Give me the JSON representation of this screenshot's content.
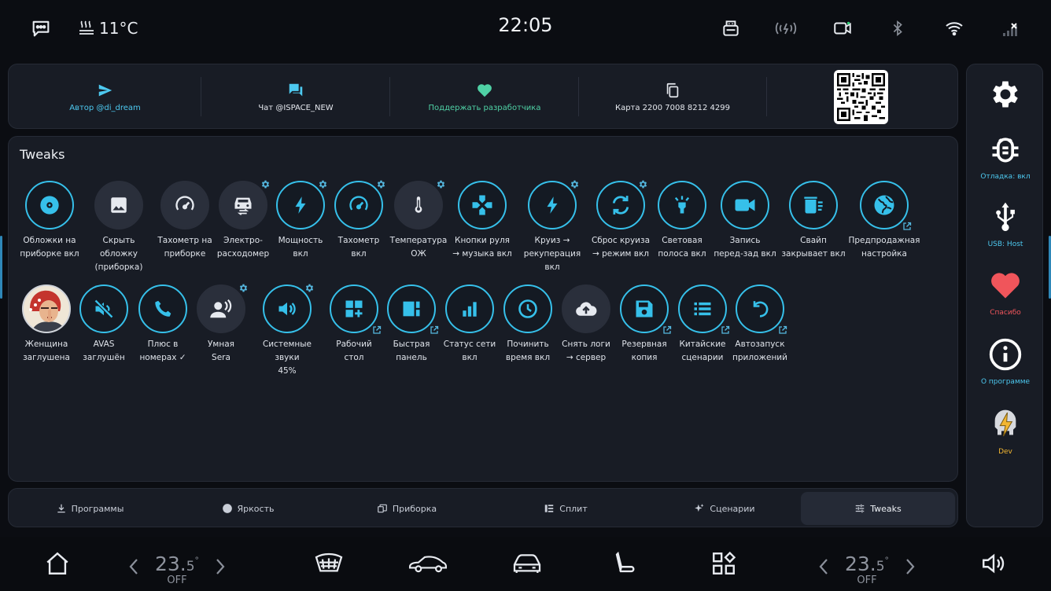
{
  "status": {
    "temperature": "11°C",
    "time": "22:05"
  },
  "links": [
    {
      "label": "Автор @di_dream"
    },
    {
      "label": "Чат @ISPACE_NEW"
    },
    {
      "label": "Поддержать разработчика"
    },
    {
      "label": "Карта 2200 7008 8212 4299"
    }
  ],
  "main": {
    "title": "Tweaks",
    "row1": [
      {
        "label": "Обложки на\nприборке вкл",
        "icon": "disc-icon",
        "state": "on"
      },
      {
        "label": "Скрыть\nобложку\n(приборка)",
        "icon": "image-icon",
        "state": "off"
      },
      {
        "label": "Тахометр на\nприборке",
        "icon": "speedometer-icon",
        "state": "off"
      },
      {
        "label": "Электро-\nрасходомер",
        "icon": "car-energy-icon",
        "state": "off",
        "gear": true
      },
      {
        "label": "Мощность\nвкл",
        "icon": "bolt-icon",
        "state": "on",
        "gear": true
      },
      {
        "label": "Тахометр\nвкл",
        "icon": "speedometer-icon",
        "state": "on",
        "gear": true
      },
      {
        "label": "Температура\nОЖ",
        "icon": "thermometer-icon",
        "state": "off",
        "gear": true
      },
      {
        "label": "Кнопки руля\n→ музыка вкл",
        "icon": "gamepad-icon",
        "state": "on"
      },
      {
        "label": "Круиз →\nрекуперация\nвкл",
        "icon": "bolt-icon",
        "state": "on",
        "gear": true
      },
      {
        "label": "Сброс круиза\n→ режим вкл",
        "icon": "sync-icon",
        "state": "on",
        "gear": true
      },
      {
        "label": "Световая\nполоса вкл",
        "icon": "light-icon",
        "state": "on"
      },
      {
        "label": "Запись\nперед-зад вкл",
        "icon": "videocam-icon",
        "state": "on"
      },
      {
        "label": "Свайп\nзакрывает вкл",
        "icon": "clear-list-icon",
        "state": "on"
      },
      {
        "label": "Предпродажная\nнастройка",
        "icon": "globe-icon",
        "state": "on",
        "ext": true
      }
    ],
    "row2": [
      {
        "label": "Женщина\nзаглушена",
        "icon": "woman-avatar-icon",
        "state": "avatar"
      },
      {
        "label": "AVAS\nзаглушён",
        "icon": "volume-off-icon",
        "state": "on"
      },
      {
        "label": "Плюс в\nномерах ✓",
        "icon": "phone-icon",
        "state": "on"
      },
      {
        "label": "Умная\nSera",
        "icon": "voice-person-icon",
        "state": "off",
        "gear": true
      },
      {
        "label": "Системные\nзвуки\n45%",
        "icon": "volume-icon",
        "state": "on",
        "gear": true
      },
      {
        "label": "Рабочий\nстол",
        "icon": "dashboard-add-icon",
        "state": "on",
        "ext": true
      },
      {
        "label": "Быстрая\nпанель",
        "icon": "panel-icon",
        "state": "on",
        "ext": true
      },
      {
        "label": "Статус сети\nвкл",
        "icon": "signal-bars-icon",
        "state": "on"
      },
      {
        "label": "Починить\nвремя вкл",
        "icon": "clock-icon",
        "state": "on"
      },
      {
        "label": "Снять логи\n→ сервер",
        "icon": "cloud-upload-icon",
        "state": "off"
      },
      {
        "label": "Резервная\nкопия",
        "icon": "save-icon",
        "state": "on",
        "ext": true
      },
      {
        "label": "Китайские\nсценарии",
        "icon": "list-icon",
        "state": "on",
        "ext": true
      },
      {
        "label": "Автозапуск\nприложений",
        "icon": "restart-icon",
        "state": "on",
        "ext": true
      }
    ]
  },
  "tabs": [
    {
      "label": "Программы",
      "icon": "download-icon"
    },
    {
      "label": "Яркость",
      "icon": "brightness-icon"
    },
    {
      "label": "Приборка",
      "icon": "cluster-icon"
    },
    {
      "label": "Сплит",
      "icon": "split-icon"
    },
    {
      "label": "Сценарии",
      "icon": "sparkle-icon"
    },
    {
      "label": "Tweaks",
      "icon": "tune-icon",
      "active": true
    }
  ],
  "side": [
    {
      "label": "",
      "icon": "gear-icon"
    },
    {
      "label": "Отладка: вкл",
      "icon": "bug-icon",
      "color": "#4dc9f0"
    },
    {
      "label": "USB: Host",
      "icon": "usb-icon",
      "color": "#4dc9f0"
    },
    {
      "label": "Спасибо",
      "icon": "heart-icon",
      "color": "#f0555b"
    },
    {
      "label": "О программе",
      "icon": "info-icon",
      "color": "#4dc9f0"
    },
    {
      "label": "Dev",
      "icon": "dev-bolt-icon",
      "color": "#f2b631"
    }
  ],
  "climate": {
    "left": {
      "whole": "23.",
      "decimal": "5",
      "deg": "°",
      "mode": "OFF"
    },
    "right": {
      "whole": "23.",
      "decimal": "5",
      "deg": "°",
      "mode": "OFF"
    }
  },
  "colors": {
    "accent": "#36c0ea",
    "panel": "#181c25",
    "heart": "#f0555b",
    "green": "#4fd1a5",
    "dev": "#f2b631"
  }
}
